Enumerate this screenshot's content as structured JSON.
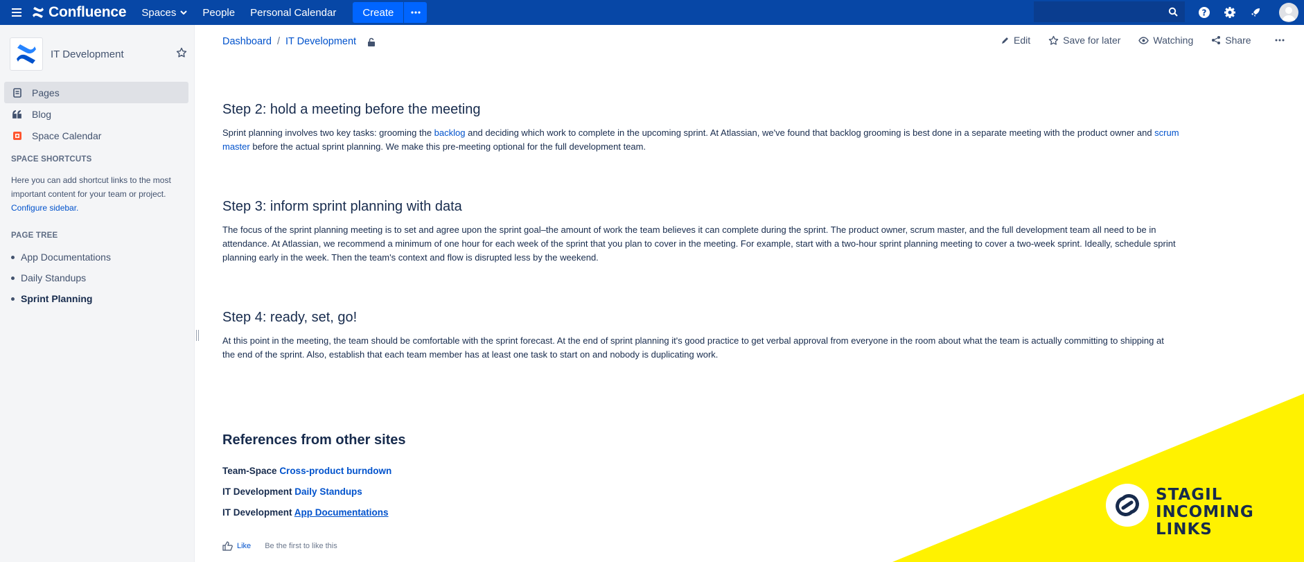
{
  "topnav": {
    "brand": "Confluence",
    "spaces": "Spaces",
    "people": "People",
    "calendar": "Personal Calendar",
    "create": "Create"
  },
  "sidebar": {
    "space_name": "IT Development",
    "nav": [
      {
        "label": "Pages",
        "icon": "pages-icon"
      },
      {
        "label": "Blog",
        "icon": "quote-icon"
      },
      {
        "label": "Space Calendar",
        "icon": "calendar-icon"
      }
    ],
    "shortcuts_heading": "SPACE SHORTCUTS",
    "shortcuts_text": "Here you can add shortcut links to the most important content for your team or project.",
    "configure_link": "Configure sidebar.",
    "tree_heading": "PAGE TREE",
    "tree": [
      "App Documentations",
      "Daily Standups",
      "Sprint Planning"
    ]
  },
  "breadcrumb": {
    "root": "Dashboard",
    "space": "IT Development"
  },
  "actions": {
    "edit": "Edit",
    "save": "Save for later",
    "watch": "Watching",
    "share": "Share"
  },
  "content": {
    "step2_title": "Step 2: hold a meeting before the meeting",
    "step2_a": "Sprint planning involves two key tasks: grooming the ",
    "step2_link1": "backlog",
    "step2_b": " and deciding which work to complete in the upcoming sprint. At Atlassian, we've found that backlog grooming is best done in a separate meeting with the product owner and ",
    "step2_link2a": "scrum",
    "step2_link2b": "master",
    "step2_c": " before the actual sprint planning. We make this pre-meeting optional for the full development team.",
    "step3_title": "Step 3: inform sprint planning with data",
    "step3_line1": "The focus of the sprint planning meeting is to set and agree upon the sprint goal–the amount of work the team believes it can complete during the sprint. The product owner, scrum master, and the full development team all need to be in",
    "step3_line2": "attendance. At Atlassian, we recommend a minimum of one hour for each week of the sprint that you plan to cover in the meeting. For example, start with a two-hour sprint planning meeting to cover a two-week sprint. Ideally, schedule sprint",
    "step3_line3": "planning early in the week. Then the team's context and flow is disrupted less by the weekend.",
    "step4_title": "Step 4: ready, set, go!",
    "step4_line1": "At this point in the meeting, the team should be comfortable with the sprint forecast. At the end of sprint planning it's good practice to get verbal approval from everyone in the room about what the team is actually committing to shipping at",
    "step4_line2": "the end of the sprint. Also, establish that each team member has at least one task to start on and nobody is duplicating work."
  },
  "references": {
    "heading": "References from other sites",
    "items": [
      {
        "space": "Team-Space",
        "page": "Cross-product burndown"
      },
      {
        "space": "IT Development",
        "page": "Daily Standups"
      },
      {
        "space": "IT Development",
        "page": "App Documentations"
      }
    ]
  },
  "like": {
    "label": "Like",
    "text": "Be the first to like this"
  },
  "banner": {
    "line1": "STAGIL",
    "line2": "INCOMING",
    "line3": "LINKS",
    "color": "#fff200"
  },
  "colors": {
    "nav": "#0747a6",
    "link": "#0052cc",
    "create": "#0065ff"
  }
}
